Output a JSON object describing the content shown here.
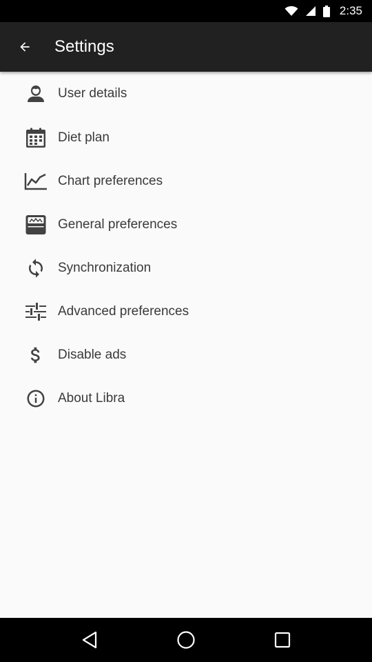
{
  "status_bar": {
    "time": "2:35"
  },
  "app_bar": {
    "title": "Settings",
    "back_icon": "arrow-back-icon"
  },
  "settings": {
    "items": [
      {
        "label": "User details",
        "icon": "user-icon"
      },
      {
        "label": "Diet plan",
        "icon": "calendar-icon"
      },
      {
        "label": "Chart preferences",
        "icon": "chart-line-icon"
      },
      {
        "label": "General preferences",
        "icon": "scale-icon"
      },
      {
        "label": "Synchronization",
        "icon": "sync-icon"
      },
      {
        "label": "Advanced preferences",
        "icon": "sliders-icon"
      },
      {
        "label": "Disable ads",
        "icon": "dollar-icon"
      },
      {
        "label": "About Libra",
        "icon": "info-icon"
      }
    ]
  },
  "nav_bar": {
    "back": "nav-back-icon",
    "home": "nav-home-icon",
    "recents": "nav-recents-icon"
  },
  "colors": {
    "app_bar": "#212121",
    "background": "#fafafa",
    "icon": "#424242",
    "text": "#3a3a3a"
  }
}
